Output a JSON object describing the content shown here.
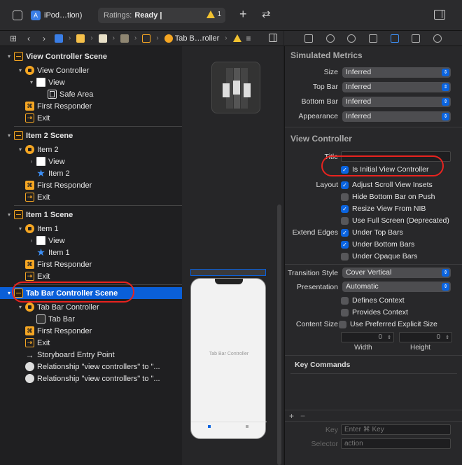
{
  "toolbar": {
    "scheme_name": "iPod…tion)",
    "status_label": "Ratings:",
    "status_value": "Ready |",
    "warning_count": "1",
    "add_symbol": "+",
    "swap_symbol": "⇄"
  },
  "jumpbar": {
    "grid_symbol": "⊞",
    "back_symbol": "‹",
    "forward_symbol": "›",
    "crumb_last": "Tab B…roller",
    "list_symbol": "≡"
  },
  "outline": {
    "rows": [
      {
        "label": "View Controller Scene",
        "icon": "scene-icon",
        "indent": 0,
        "disclosure": "▾",
        "bold": true
      },
      {
        "label": "View Controller",
        "icon": "view-controller-icon",
        "indent": 1,
        "disclosure": "▾"
      },
      {
        "label": "View",
        "icon": "view-icon",
        "indent": 2,
        "disclosure": "▾"
      },
      {
        "label": "Safe Area",
        "icon": "safe-area-icon",
        "indent": 3,
        "disclosure": ""
      },
      {
        "label": "First Responder",
        "icon": "first-responder-icon",
        "indent": 1,
        "disclosure": ""
      },
      {
        "label": "Exit",
        "icon": "exit-icon",
        "indent": 1,
        "disclosure": ""
      },
      {
        "label": "Item 2 Scene",
        "icon": "scene-icon",
        "indent": 0,
        "disclosure": "▾",
        "bold": true
      },
      {
        "label": "Item 2",
        "icon": "view-controller-icon",
        "indent": 1,
        "disclosure": "▾"
      },
      {
        "label": "View",
        "icon": "view-icon",
        "indent": 2,
        "disclosure": "›"
      },
      {
        "label": "Item 2",
        "icon": "star-icon",
        "indent": 2,
        "disclosure": ""
      },
      {
        "label": "First Responder",
        "icon": "first-responder-icon",
        "indent": 1,
        "disclosure": ""
      },
      {
        "label": "Exit",
        "icon": "exit-icon",
        "indent": 1,
        "disclosure": ""
      },
      {
        "label": "Item 1 Scene",
        "icon": "scene-icon",
        "indent": 0,
        "disclosure": "▾",
        "bold": true
      },
      {
        "label": "Item 1",
        "icon": "view-controller-icon",
        "indent": 1,
        "disclosure": "▾"
      },
      {
        "label": "View",
        "icon": "view-icon",
        "indent": 2,
        "disclosure": "›"
      },
      {
        "label": "Item 1",
        "icon": "star-icon",
        "indent": 2,
        "disclosure": ""
      },
      {
        "label": "First Responder",
        "icon": "first-responder-icon",
        "indent": 1,
        "disclosure": ""
      },
      {
        "label": "Exit",
        "icon": "exit-icon",
        "indent": 1,
        "disclosure": ""
      },
      {
        "label": "Tab Bar Controller Scene",
        "icon": "scene-icon",
        "indent": 0,
        "disclosure": "▾",
        "bold": true,
        "selected": true
      },
      {
        "label": "Tab Bar Controller",
        "icon": "view-controller-icon",
        "indent": 1,
        "disclosure": "▾"
      },
      {
        "label": "Tab Bar",
        "icon": "tab-bar-icon",
        "indent": 2,
        "disclosure": ""
      },
      {
        "label": "First Responder",
        "icon": "first-responder-icon",
        "indent": 1,
        "disclosure": ""
      },
      {
        "label": "Exit",
        "icon": "exit-icon",
        "indent": 1,
        "disclosure": ""
      },
      {
        "label": "Storyboard Entry Point",
        "icon": "entry-arrow-icon",
        "indent": 1,
        "disclosure": ""
      },
      {
        "label": "Relationship \"view controllers\" to \"...",
        "icon": "relationship-icon",
        "indent": 1,
        "disclosure": ""
      },
      {
        "label": "Relationship \"view controllers\" to \"...",
        "icon": "relationship-icon",
        "indent": 1,
        "disclosure": ""
      }
    ]
  },
  "canvas": {
    "phone_title": "Tab Bar Controller"
  },
  "inspector": {
    "simulated_metrics_title": "Simulated Metrics",
    "metrics": [
      {
        "label": "Size",
        "value": "Inferred"
      },
      {
        "label": "Top Bar",
        "value": "Inferred"
      },
      {
        "label": "Bottom Bar",
        "value": "Inferred"
      },
      {
        "label": "Appearance",
        "value": "Inferred"
      }
    ],
    "vc_title": "View Controller",
    "title_label": "Title",
    "initial_vc": {
      "label": "Is Initial View Controller",
      "checked": true
    },
    "layout_label": "Layout",
    "layout_options": [
      {
        "label": "Adjust Scroll View Insets",
        "checked": true
      },
      {
        "label": "Hide Bottom Bar on Push",
        "checked": false
      },
      {
        "label": "Resize View From NIB",
        "checked": true
      },
      {
        "label": "Use Full Screen (Deprecated)",
        "checked": false
      }
    ],
    "extend_edges_label": "Extend Edges",
    "extend_edges": [
      {
        "label": "Under Top Bars",
        "checked": true
      },
      {
        "label": "Under Bottom Bars",
        "checked": true
      },
      {
        "label": "Under Opaque Bars",
        "checked": false
      }
    ],
    "transition_style_label": "Transition Style",
    "transition_style_value": "Cover Vertical",
    "presentation_label": "Presentation",
    "presentation_value": "Automatic",
    "defines_context": {
      "label": "Defines Context",
      "checked": false
    },
    "provides_context": {
      "label": "Provides Context",
      "checked": false
    },
    "content_size_label": "Content Size",
    "use_preferred": {
      "label": "Use Preferred Explicit Size",
      "checked": false
    },
    "width_value": "0",
    "height_value": "0",
    "width_label": "Width",
    "height_label": "Height",
    "key_commands_title": "Key Commands",
    "add_symbol": "+",
    "remove_symbol": "−",
    "key_label": "Key",
    "key_placeholder": "Enter ⌘ Key",
    "selector_label": "Selector",
    "selector_placeholder": "action"
  },
  "colors": {
    "selection": "#0a5fd8",
    "accent": "#0a64e0",
    "highlight_ring": "#e8231f",
    "scene_icon": "#f5a623"
  }
}
